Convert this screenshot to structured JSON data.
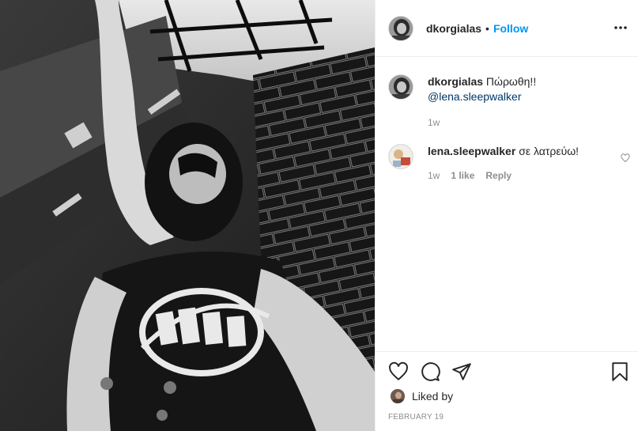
{
  "post": {
    "author": "dkorgialas",
    "separator": "•",
    "follow_label": "Follow",
    "more_icon": "more-horizontal-icon"
  },
  "caption": {
    "author": "dkorgialas",
    "text": "Πώρωθη!!",
    "mention": "@lena.sleepwalker",
    "time": "1w"
  },
  "comments": [
    {
      "author": "lena.sleepwalker",
      "text": "σε λατρεύω!",
      "time": "1w",
      "likes": "1 like",
      "reply_label": "Reply"
    }
  ],
  "actions": {
    "icons": [
      "heart-icon",
      "comment-icon",
      "share-icon",
      "bookmark-icon"
    ],
    "liked_by_label": "Liked by",
    "date": "FEBRUARY 19"
  },
  "colors": {
    "accent": "#0095f6",
    "mention": "#00376b",
    "muted": "#8e8e8e",
    "text": "#262626",
    "divider": "#efefef"
  }
}
